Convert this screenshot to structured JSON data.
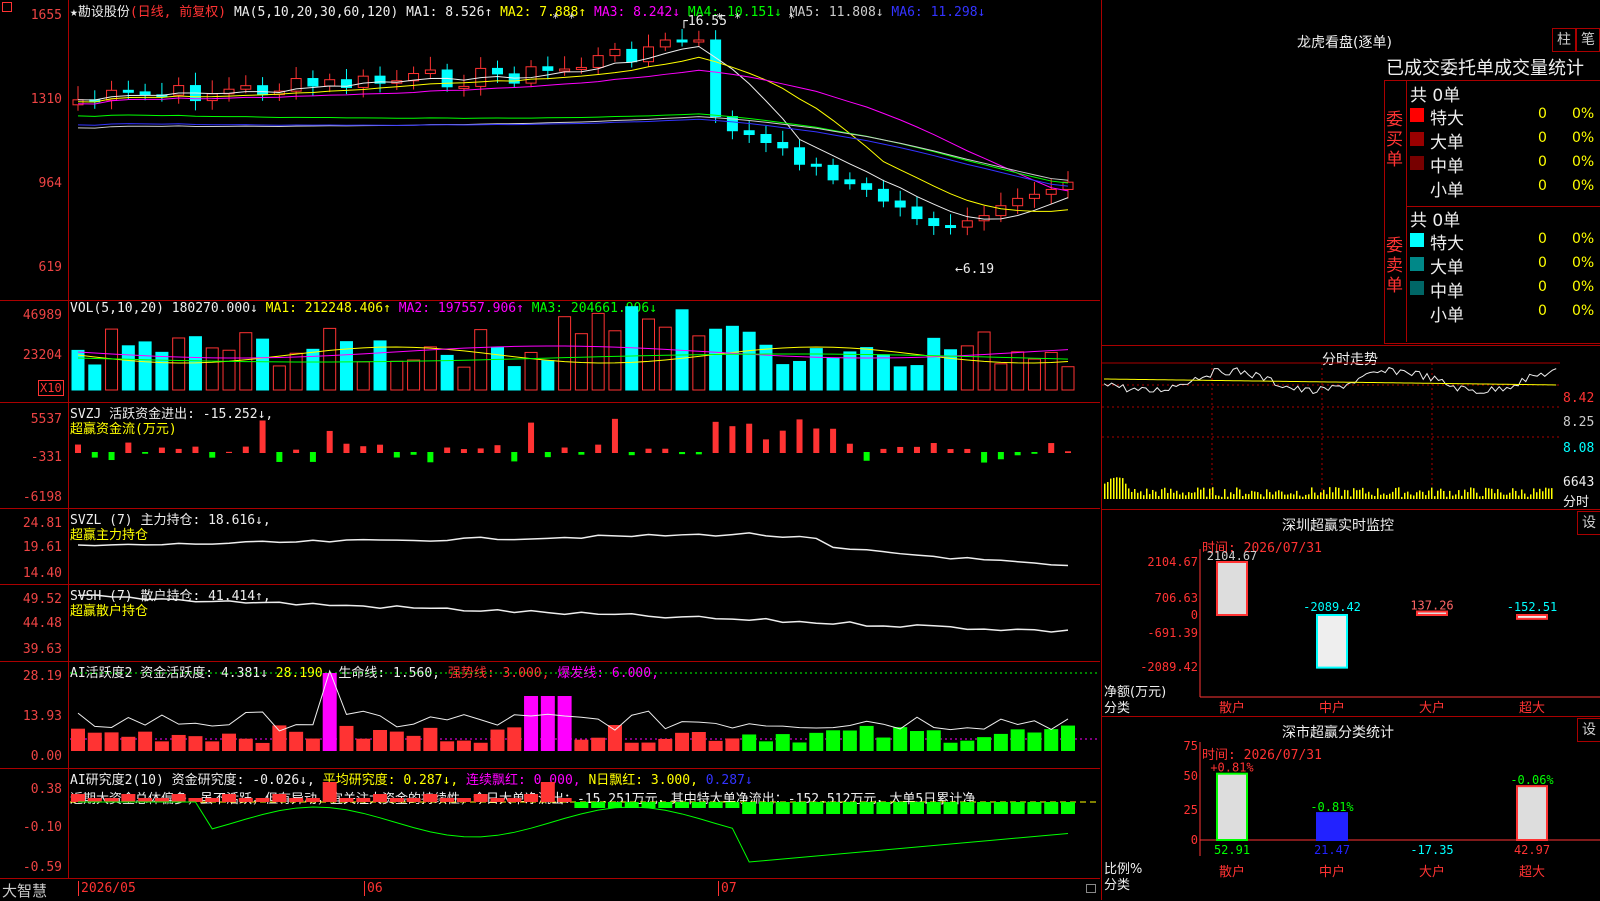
{
  "chart_title": "★勘设股份",
  "chart_mode": "(日线, 前复权)",
  "ma_header": {
    "label": "MA(5,10,20,30,60,120)",
    "items": [
      {
        "t": "MA1: 8.526↑",
        "c": "#eee"
      },
      {
        "t": "MA2: 7.888↑",
        "c": "#ff0"
      },
      {
        "t": "MA3: 8.242↓",
        "c": "#f0f"
      },
      {
        "t": "MA4: 10.151↓",
        "c": "#0f0"
      },
      {
        "t": "MA5: 11.808↓",
        "c": "#ccc"
      },
      {
        "t": "MA6: 11.298↓",
        "c": "#33f"
      }
    ]
  },
  "price_axis": [
    "1655",
    "1310",
    "964",
    "619"
  ],
  "price_annotations": {
    "high": "16.55",
    "low": "6.19"
  },
  "vol_header": {
    "label": "VOL(5,10,20)",
    "value": "180270.000↓",
    "ma1": "MA1: 212248.406↑",
    "ma2": "MA2: 197557.906↑",
    "ma3": "MA3: 204661.906↓"
  },
  "vol_axis": [
    "46989",
    "23204"
  ],
  "vol_scale": "X10",
  "svzj": {
    "label": "SVZJ  活跃资金进出: -15.252↓,",
    "sub": "超赢资金流(万元)",
    "axis": [
      "5537",
      "-331",
      "-6198"
    ]
  },
  "svzl": {
    "label": "SVZL (7) 主力持仓: 18.616↓,",
    "sub": "超赢主力持仓",
    "axis": [
      "24.81",
      "19.61",
      "14.40"
    ]
  },
  "svsh": {
    "label": "SVSH (7) 散户持仓: 41.414↑,",
    "sub": "超赢散户持仓",
    "axis": [
      "49.52",
      "44.48",
      "39.63"
    ]
  },
  "ai1": {
    "label": "AI活跃度2 资金活跃度: 4.381↓",
    "v2": "28.190,",
    "v3": "生命线: 1.560,",
    "v4": "强势线: 3.000,",
    "v5": "爆发线: 6.000,",
    "axis": [
      "28.19",
      "13.93",
      "0.00"
    ]
  },
  "ai2": {
    "label": "AI研究度2(10) 资金研究度: -0.026↓,",
    "v2": "平均研究度: 0.287↓,",
    "v3": "连续飘红: 0.000,",
    "v4": "N日飘红: 3.000,",
    "v5": "0.287↓",
    "axis": [
      "0.38",
      "-0.10",
      "-0.59"
    ],
    "comment": "近期大资金总体偏多，虽不活跃，但有异动，宜关注大资金的持续性，今日大单净流出：-15.251万元，其中特大单净流出：-152.512万元，大单5日累计净"
  },
  "xaxis": {
    "corner": "大智慧",
    "labels": [
      "2026/05",
      "06",
      "07"
    ]
  },
  "lhb": {
    "title": "龙虎看盘(逐单)",
    "btn1": "柱",
    "btn2": "笔",
    "tabs": "已成交委托单成交量统计",
    "buy_side": "委买单",
    "sell_side": "委卖单",
    "buy_total": "共 0单",
    "sell_total": "共 0单",
    "buy_rows": [
      {
        "n": "特大",
        "c": "#f00",
        "v": "0",
        "p": "0%"
      },
      {
        "n": "大单",
        "c": "#900",
        "v": "0",
        "p": "0%"
      },
      {
        "n": "中单",
        "c": "#700",
        "v": "0",
        "p": "0%"
      },
      {
        "n": "小单",
        "c": "",
        "v": "0",
        "p": "0%"
      }
    ],
    "sell_rows": [
      {
        "n": "特大",
        "c": "#0ff",
        "v": "0",
        "p": "0%"
      },
      {
        "n": "大单",
        "c": "#088",
        "v": "0",
        "p": "0%"
      },
      {
        "n": "中单",
        "c": "#066",
        "v": "0",
        "p": "0%"
      },
      {
        "n": "小单",
        "c": "",
        "v": "0",
        "p": "0%"
      }
    ]
  },
  "intraday": {
    "title": "分时走势",
    "axis": [
      "8.42",
      "8.25",
      "8.08"
    ],
    "vol": "6643",
    "vol_unit": "分时"
  },
  "monitor": {
    "title": "深圳超赢实时监控",
    "btn": "设",
    "time": "时间: 2026/07/31",
    "ylabel": "净额(万元)",
    "xlabel": "分类",
    "axis": [
      "2104.67",
      "706.63",
      "0",
      "-691.39",
      "-2089.42"
    ],
    "bars": [
      {
        "cat": "散户",
        "v": "2104.67"
      },
      {
        "cat": "中户",
        "v": "-2089.42"
      },
      {
        "cat": "大户",
        "v": "137.26"
      },
      {
        "cat": "超大",
        "v": "-152.51"
      }
    ]
  },
  "classstat": {
    "title": "深市超赢分类统计",
    "btn": "设",
    "time": "时间: 2026/07/31",
    "ylabel": "比例%",
    "xlabel": "分类",
    "axis": [
      "75",
      "50",
      "25",
      "0"
    ],
    "bars": [
      {
        "cat": "散户",
        "top": "+0.81%",
        "val": "52.91"
      },
      {
        "cat": "中户",
        "top": "-0.81%",
        "val": "21.47"
      },
      {
        "cat": "大户",
        "top": "",
        "val": "-17.35"
      },
      {
        "cat": "超大",
        "top": "-0.06%",
        "val": "42.97"
      }
    ]
  }
}
